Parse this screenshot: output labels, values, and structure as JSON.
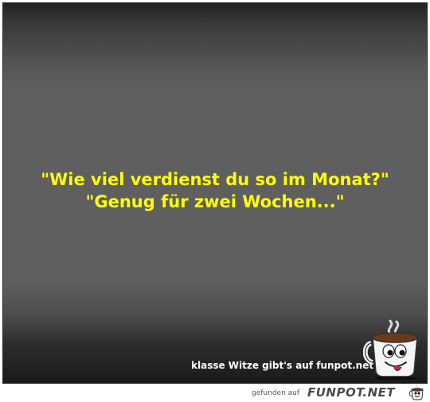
{
  "joke": {
    "line1": "\"Wie viel verdienst du so im Monat?\"",
    "line2": "\"Genug für zwei Wochen...\""
  },
  "tagline": "klasse Witze gibt's auf funpot.net",
  "footer": {
    "found_label": "gefunden auf",
    "brand": "FUNPOT.NET"
  },
  "colors": {
    "joke_text": "#ffff00",
    "background": "#5f5f5f",
    "tagline_text": "#ffffff"
  },
  "icons": {
    "mascot": "coffee-mug-mascot-icon",
    "footer_logo": "coffee-mug-logo-icon"
  }
}
